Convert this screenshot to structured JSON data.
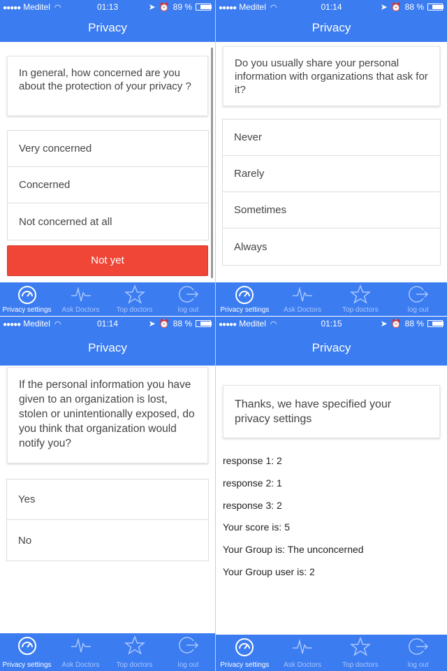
{
  "panels": [
    {
      "status": {
        "carrier": "Meditel",
        "time": "01:13",
        "battery": "89 %"
      },
      "title": "Privacy",
      "question": "In general, how concerned are you about the protection of your privacy ?",
      "options": [
        "Very concerned",
        "Concerned",
        "Not concerned at all"
      ],
      "button_label": "Not yet"
    },
    {
      "status": {
        "carrier": "Meditel",
        "time": "01:14",
        "battery": "88 %"
      },
      "title": "Privacy",
      "question": "Do you usually share your personal information with organizations that ask for it?",
      "options": [
        "Never",
        "Rarely",
        "Sometimes",
        "Always"
      ]
    },
    {
      "status": {
        "carrier": "Meditel",
        "time": "01:14",
        "battery": "88 %"
      },
      "title": "Privacy",
      "question": "If the personal information you have given to an organization is lost, stolen or unintentionally exposed, do you think that organization would notify you?",
      "options": [
        "Yes",
        "No"
      ]
    },
    {
      "status": {
        "carrier": "Meditel",
        "time": "01:15",
        "battery": "88 %"
      },
      "title": "Privacy",
      "message": "Thanks, we have specified your privacy settings",
      "results": [
        "response 1: 2",
        "response 2: 1",
        "response 3: 2",
        "Your score is: 5",
        "Your Group is: The unconcerned",
        "Your Group user is: 2"
      ]
    }
  ],
  "tabs": [
    {
      "label": "Privacy settings",
      "icon": "gauge-icon"
    },
    {
      "label": "Ask Doctors",
      "icon": "pulse-icon"
    },
    {
      "label": "Top doctors",
      "icon": "star-icon"
    },
    {
      "label": "log out",
      "icon": "logout-icon"
    }
  ],
  "colors": {
    "primary": "#3b7cf0",
    "danger": "#ef4638"
  }
}
